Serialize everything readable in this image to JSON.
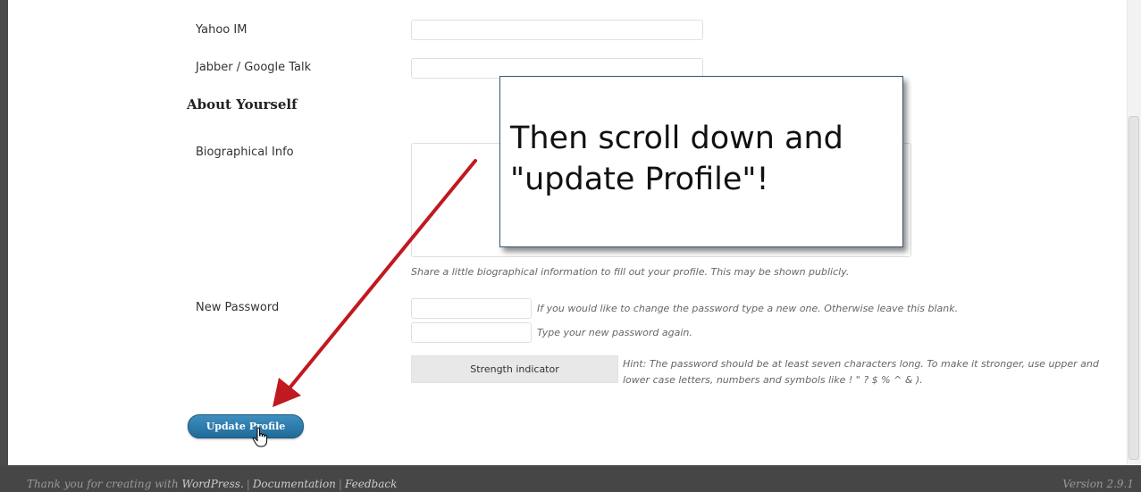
{
  "profile_form": {
    "yahoo_label": "Yahoo IM",
    "jabber_label": "Jabber / Google Talk",
    "about_heading": "About Yourself",
    "bio_label": "Biographical Info",
    "bio_help": "Share a little biographical information to fill out your profile. This may be shown publicly.",
    "new_password_label": "New Password",
    "password_help": "If you would like to change the password type a new one. Otherwise leave this blank.",
    "password_again_help": "Type your new password again.",
    "strength_indicator": "Strength indicator",
    "password_hint": "Hint: The password should be at least seven characters long. To make it stronger, use upper and lower case letters, numbers and symbols like ! \" ? $ % ^ & ).",
    "update_button": "Update Profile"
  },
  "annotation": {
    "callout_line1": "Then scroll down and",
    "callout_line2": "\"update Profile\"!",
    "callout_border_color": "#3b5676",
    "arrow_color": "#c0191f"
  },
  "footer": {
    "thanks_prefix": "Thank you for creating with ",
    "wordpress": "WordPress.",
    "separator": "|",
    "documentation": "Documentation",
    "feedback": "Feedback",
    "version": "Version 2.9.1"
  },
  "colors": {
    "button": "#2a77a6",
    "footer_bg": "#464646"
  }
}
